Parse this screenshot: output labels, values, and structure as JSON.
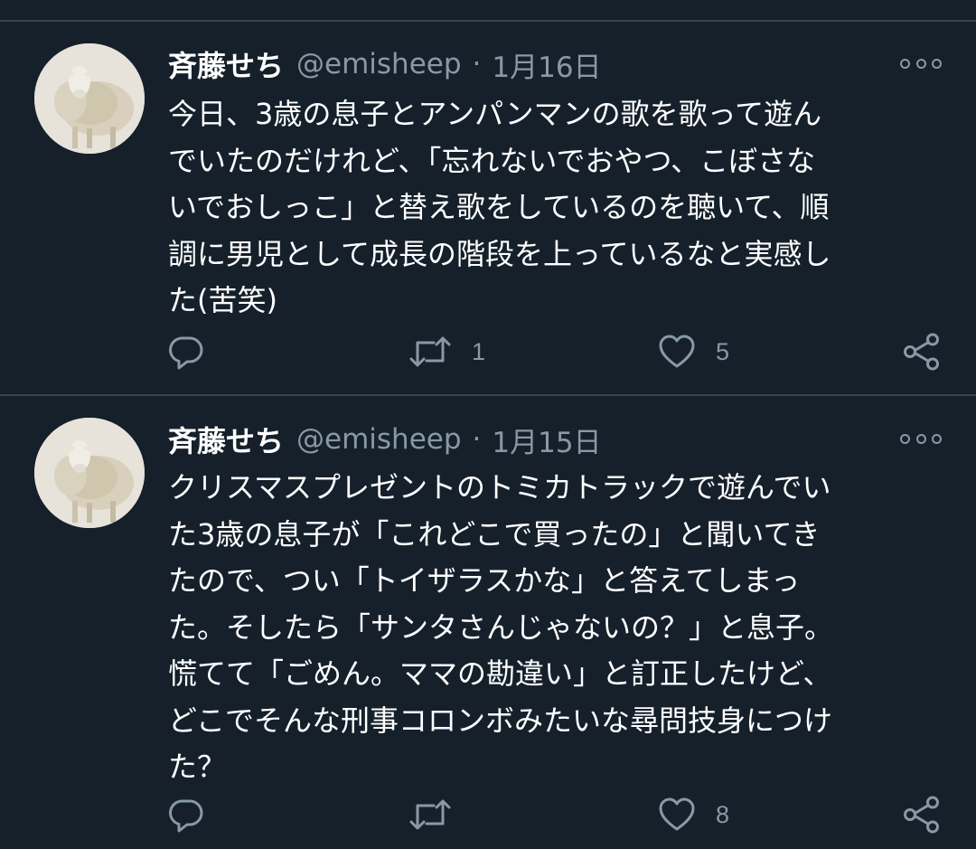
{
  "tweets": [
    {
      "name": "斉藤せち",
      "handle": "@emisheep",
      "separator": "·",
      "date": "1月16日",
      "text_lines": [
        "今日、3歳の息子とアンパンマンの歌を歌って遊ん",
        "でいたのだけれど、「忘れないでおやつ、こぼさな",
        "いでおしっこ」と替え歌をしているのを聴いて、順",
        "調に男児として成長の階段を上っているなと実感し",
        "た(苦笑)"
      ],
      "reply_count": "",
      "retweet_count": "1",
      "like_count": "5",
      "icons": {
        "more": "more-icon",
        "reply": "reply-icon",
        "retweet": "retweet-icon",
        "like": "heart-icon",
        "share": "share-icon"
      }
    },
    {
      "name": "斉藤せち",
      "handle": "@emisheep",
      "separator": "·",
      "date": "1月15日",
      "text_lines": [
        "クリスマスプレゼントのトミカトラックで遊んでい",
        "た3歳の息子が「これどこで買ったの」と聞いてき",
        "たので、つい「トイザラスかな」と答えてしまっ",
        "た。そしたら「サンタさんじゃないの？」と息子。",
        "慌てて「ごめん。ママの勘違い」と訂正したけど、",
        "どこでそんな刑事コロンボみたいな尋問技身につけ",
        "た？"
      ],
      "reply_count": "",
      "retweet_count": "",
      "like_count": "8",
      "icons": {
        "more": "more-icon",
        "reply": "reply-icon",
        "retweet": "retweet-icon",
        "like": "heart-icon",
        "share": "share-icon"
      }
    }
  ],
  "colors": {
    "background": "#15202b",
    "divider": "#38444d",
    "secondary_text": "#8899a6",
    "primary_text": "#ffffff"
  }
}
